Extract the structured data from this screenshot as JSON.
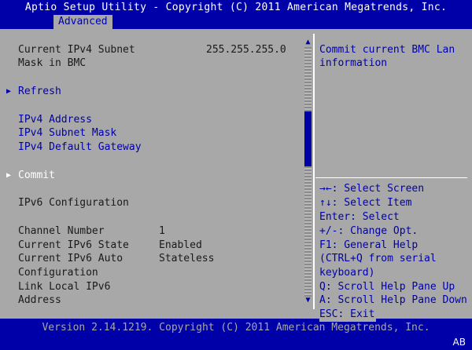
{
  "title": "Aptio Setup Utility - Copyright (C) 2011 American Megatrends, Inc.",
  "tabs": [
    {
      "label": "Advanced"
    }
  ],
  "left": {
    "subnet_label_1": "Current IPv4 Subnet",
    "subnet_label_2": "Mask in BMC",
    "subnet_value": "255.255.255.0",
    "refresh": "Refresh",
    "ipv4_address": "IPv4 Address",
    "ipv4_subnet_mask": "IPv4 Subnet Mask",
    "ipv4_gateway": "IPv4 Default Gateway",
    "commit": "Commit",
    "ipv6_config": "IPv6 Configuration",
    "channel_label": "Channel Number",
    "channel_value": "1",
    "ipv6_state_label": "Current IPv6 State",
    "ipv6_state_value": "Enabled",
    "ipv6_auto_label_1": "Current IPv6 Auto",
    "ipv6_auto_label_2": "Configuration",
    "ipv6_auto_value": "Stateless",
    "link_local_1": "Link Local IPv6",
    "link_local_2": "Address"
  },
  "help": {
    "description_1": "Commit current BMC Lan",
    "description_2": "information",
    "keys": [
      "→←: Select Screen",
      "↑↓: Select Item",
      "Enter: Select",
      "+/-: Change Opt.",
      "F1: General Help",
      "(CTRL+Q from serial",
      "keyboard)",
      "Q: Scroll Help Pane Up",
      "A: Scroll Help Pane Down",
      "ESC: Exit"
    ]
  },
  "footer": {
    "version": "Version 2.14.1219. Copyright (C) 2011 American Megatrends, Inc.",
    "corner": "AB"
  },
  "colors": {
    "background": "#0000a8",
    "panel": "#a8a8a8",
    "highlight": "#ffffff"
  }
}
